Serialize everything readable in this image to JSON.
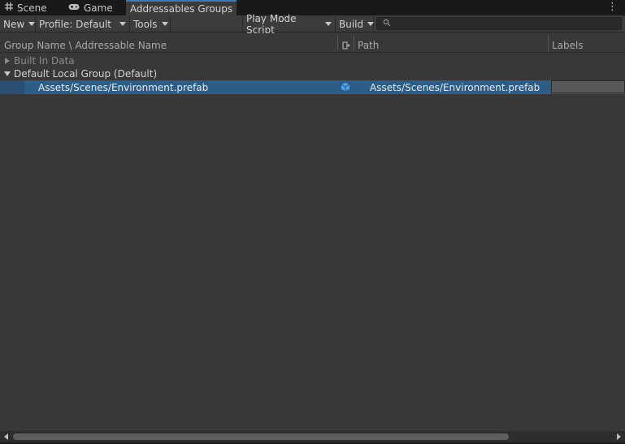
{
  "tabs": [
    {
      "label": "Scene",
      "icon": "grid-icon"
    },
    {
      "label": "Game",
      "icon": "gamepad-icon"
    },
    {
      "label": "Addressables Groups",
      "active": true
    }
  ],
  "toolbar": {
    "new_label": "New",
    "profile_label": "Profile: Default",
    "tools_label": "Tools",
    "play_mode_label": "Play Mode Script",
    "build_label": "Build",
    "search_placeholder": ""
  },
  "columns": {
    "name": "Group Name \\ Addressable Name",
    "path": "Path",
    "labels": "Labels"
  },
  "tree": {
    "built_in": "Built In Data",
    "default_group": "Default Local Group (Default)",
    "entry": {
      "name": "Assets/Scenes/Environment.prefab",
      "path": "Assets/Scenes/Environment.prefab",
      "icon": "prefab-cube-icon"
    }
  },
  "colors": {
    "accent": "#3a79bb",
    "selection": "#2c5d87",
    "prefab": "#4fa3e8"
  }
}
